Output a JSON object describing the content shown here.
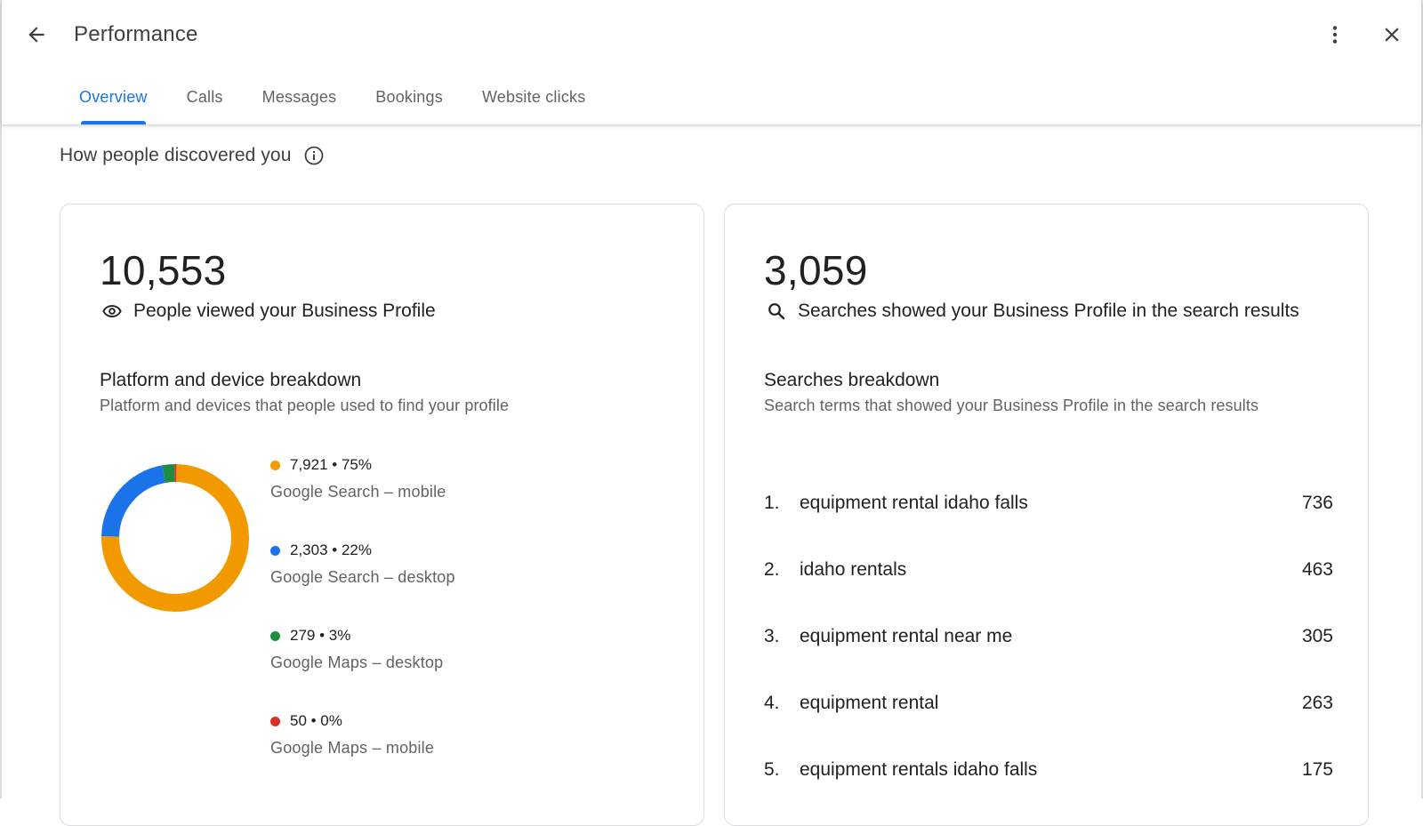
{
  "header": {
    "title": "Performance",
    "back_icon": "arrow-left-icon",
    "more_icon": "more-vert-icon",
    "close_icon": "close-icon"
  },
  "tabs": [
    {
      "label": "Overview",
      "active": true
    },
    {
      "label": "Calls",
      "active": false
    },
    {
      "label": "Messages",
      "active": false
    },
    {
      "label": "Bookings",
      "active": false
    },
    {
      "label": "Website clicks",
      "active": false
    }
  ],
  "section": {
    "heading": "How people discovered you",
    "info_icon": "info-icon"
  },
  "views_card": {
    "total": "10,553",
    "metric_label": "People viewed your Business Profile",
    "metric_icon": "eye-icon",
    "breakdown_title": "Platform and device breakdown",
    "breakdown_desc": "Platform and devices that people used to find your profile",
    "items": [
      {
        "value": "7,921 • 75%",
        "label": "Google Search – mobile",
        "color": "#f29900",
        "count": 7921
      },
      {
        "value": "2,303 • 22%",
        "label": "Google Search – desktop",
        "color": "#1a73e8",
        "count": 2303
      },
      {
        "value": "279 • 3%",
        "label": "Google Maps – desktop",
        "color": "#1e8e3e",
        "count": 279
      },
      {
        "value": "50 • 0%",
        "label": "Google Maps – mobile",
        "color": "#d93025",
        "count": 50
      }
    ]
  },
  "searches_card": {
    "total": "3,059",
    "metric_label": "Searches showed your Business Profile in the search results",
    "metric_icon": "search-icon",
    "breakdown_title": "Searches breakdown",
    "breakdown_desc": "Search terms that showed your Business Profile in the search results",
    "rows": [
      {
        "rank": "1.",
        "term": "equipment rental idaho falls",
        "count": "736"
      },
      {
        "rank": "2.",
        "term": "idaho rentals",
        "count": "463"
      },
      {
        "rank": "3.",
        "term": "equipment rental near me",
        "count": "305"
      },
      {
        "rank": "4.",
        "term": "equipment rental",
        "count": "263"
      },
      {
        "rank": "5.",
        "term": "equipment rentals idaho falls",
        "count": "175"
      }
    ]
  }
}
